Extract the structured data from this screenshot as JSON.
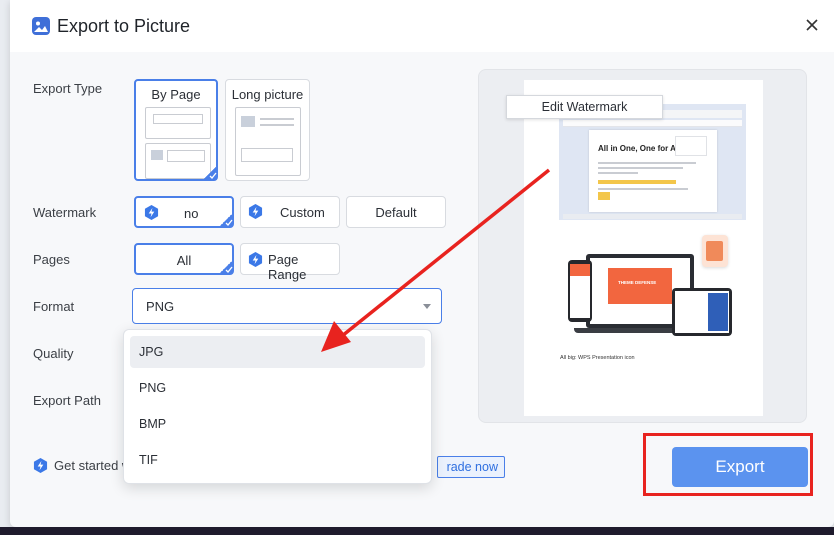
{
  "dialog": {
    "title": "Export to Picture"
  },
  "labels": {
    "export_type": "Export Type",
    "watermark": "Watermark",
    "pages": "Pages",
    "format": "Format",
    "quality": "Quality",
    "export_path": "Export Path"
  },
  "export_type": {
    "options": [
      "By Page",
      "Long picture"
    ],
    "selected": "By Page"
  },
  "watermark": {
    "options": [
      "no",
      "Custom",
      "Default"
    ],
    "selected": "no"
  },
  "pages": {
    "options": [
      "All",
      "Page Range"
    ],
    "selected": "All"
  },
  "format": {
    "value": "PNG",
    "options": [
      "JPG",
      "PNG",
      "BMP",
      "TIF"
    ],
    "highlighted": "JPG"
  },
  "preview": {
    "watermark_tag": "Edit Watermark",
    "doc_heading": "All in One, One for All",
    "doc_caption": "All big: WPS Presentation icon",
    "hero_text": "THEME DEFENSE"
  },
  "upsell": {
    "text": "Get started w",
    "button": "rade now"
  },
  "actions": {
    "export": "Export"
  },
  "colors": {
    "accent": "#4a7fe8",
    "export_button": "#5b93ef",
    "annotation_red": "#e8231f"
  }
}
